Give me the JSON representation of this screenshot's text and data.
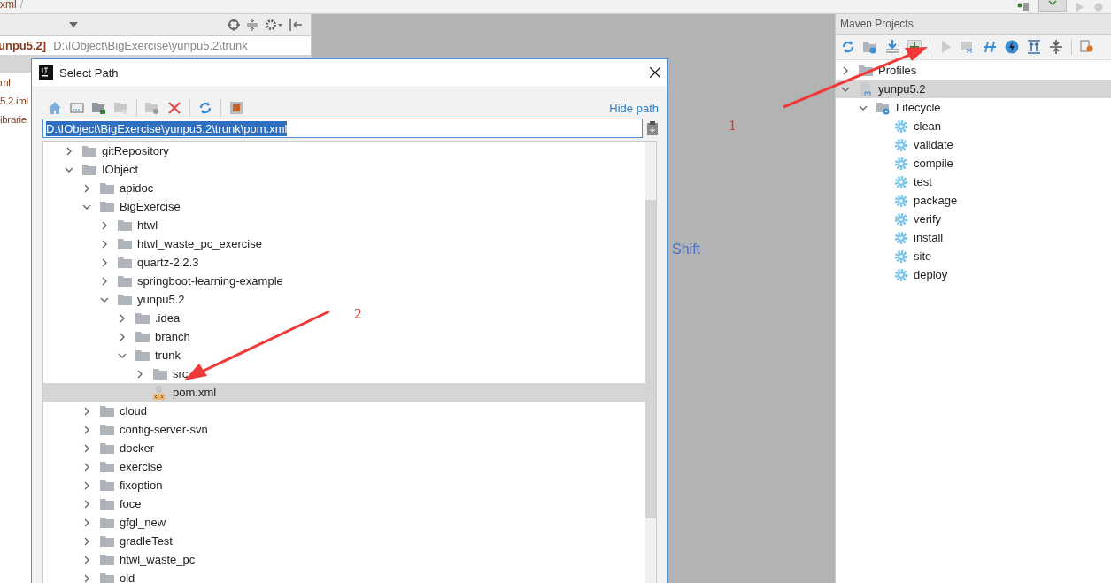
{
  "top_bar": {
    "breadcrumb": "xml",
    "separator": "/"
  },
  "project_panel": {
    "header_bold": "unpu5.2]",
    "header_path": "D:\\IObject\\BigExercise\\yunpu5.2\\trunk",
    "items": [
      {
        "label": "ml",
        "selected": false
      },
      {
        "label": "5.2.iml",
        "selected": false
      },
      {
        "label": "ibrarie",
        "selected": false
      }
    ]
  },
  "editor": {
    "hint": "Shift"
  },
  "maven": {
    "title": "Maven Projects",
    "tree": [
      {
        "label": "Profiles",
        "kind": "profiles",
        "expanded": false,
        "selected": false
      },
      {
        "label": "yunpu5.2",
        "kind": "project",
        "expanded": true,
        "selected": true,
        "children": [
          {
            "label": "Lifecycle",
            "kind": "lifecycle",
            "expanded": true,
            "selected": false,
            "children": [
              {
                "label": "clean",
                "kind": "goal",
                "selected": false
              },
              {
                "label": "validate",
                "kind": "goal",
                "selected": false
              },
              {
                "label": "compile",
                "kind": "goal",
                "selected": false
              },
              {
                "label": "test",
                "kind": "goal",
                "selected": false
              },
              {
                "label": "package",
                "kind": "goal",
                "selected": false
              },
              {
                "label": "verify",
                "kind": "goal",
                "selected": false
              },
              {
                "label": "install",
                "kind": "goal",
                "selected": false
              },
              {
                "label": "site",
                "kind": "goal",
                "selected": false
              },
              {
                "label": "deploy",
                "kind": "goal",
                "selected": false
              }
            ]
          }
        ]
      }
    ]
  },
  "dialog": {
    "title": "Select Path",
    "hide_path": "Hide path",
    "path_value": "D:\\IObject\\BigExercise\\yunpu5.2\\trunk\\pom.xml",
    "tree": [
      {
        "label": "gitRepository",
        "kind": "folder",
        "expanded": false,
        "selected": false
      },
      {
        "label": "IObject",
        "kind": "folder",
        "expanded": true,
        "selected": false,
        "children": [
          {
            "label": "apidoc",
            "kind": "folder",
            "expanded": false,
            "selected": false
          },
          {
            "label": "BigExercise",
            "kind": "folder",
            "expanded": true,
            "selected": false,
            "children": [
              {
                "label": "htwl",
                "kind": "folder",
                "expanded": false,
                "selected": false
              },
              {
                "label": "htwl_waste_pc_exercise",
                "kind": "folder",
                "expanded": false,
                "selected": false
              },
              {
                "label": "quartz-2.2.3",
                "kind": "folder",
                "expanded": false,
                "selected": false
              },
              {
                "label": "springboot-learning-example",
                "kind": "folder",
                "expanded": false,
                "selected": false
              },
              {
                "label": "yunpu5.2",
                "kind": "folder",
                "expanded": true,
                "selected": false,
                "children": [
                  {
                    "label": ".idea",
                    "kind": "folder",
                    "expanded": false,
                    "selected": false
                  },
                  {
                    "label": "branch",
                    "kind": "folder",
                    "expanded": false,
                    "selected": false
                  },
                  {
                    "label": "trunk",
                    "kind": "folder",
                    "expanded": true,
                    "selected": false,
                    "children": [
                      {
                        "label": "src",
                        "kind": "folder",
                        "expanded": false,
                        "selected": false
                      },
                      {
                        "label": "pom.xml",
                        "kind": "file",
                        "selected": true
                      }
                    ]
                  }
                ]
              }
            ]
          },
          {
            "label": "cloud",
            "kind": "folder",
            "expanded": false,
            "selected": false
          },
          {
            "label": "config-server-svn",
            "kind": "folder",
            "expanded": false,
            "selected": false
          },
          {
            "label": "docker",
            "kind": "folder",
            "expanded": false,
            "selected": false
          },
          {
            "label": "exercise",
            "kind": "folder",
            "expanded": false,
            "selected": false
          },
          {
            "label": "fixoption",
            "kind": "folder",
            "expanded": false,
            "selected": false
          },
          {
            "label": "foce",
            "kind": "folder",
            "expanded": false,
            "selected": false
          },
          {
            "label": "gfgl_new",
            "kind": "folder",
            "expanded": false,
            "selected": false
          },
          {
            "label": "gradleTest",
            "kind": "folder",
            "expanded": false,
            "selected": false
          },
          {
            "label": "htwl_waste_pc",
            "kind": "folder",
            "expanded": false,
            "selected": false
          },
          {
            "label": "old",
            "kind": "folder",
            "expanded": false,
            "selected": false
          }
        ]
      }
    ]
  },
  "annotations": [
    {
      "label": "1"
    },
    {
      "label": "2"
    }
  ]
}
